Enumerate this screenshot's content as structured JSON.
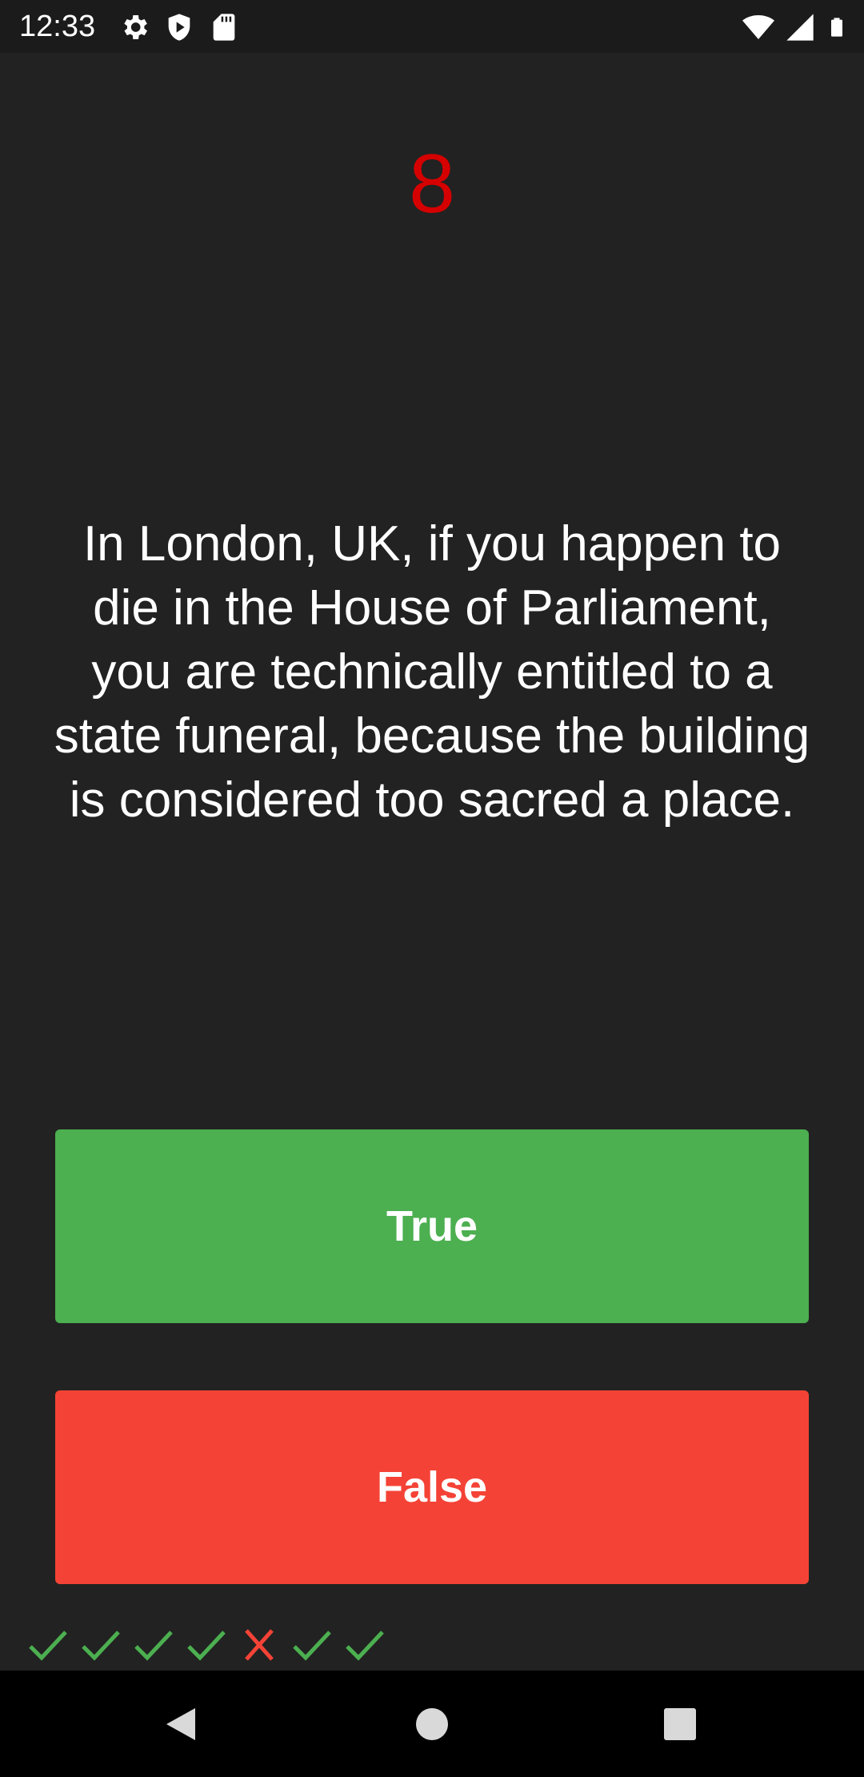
{
  "status_bar": {
    "time": "12:33",
    "left_icons": [
      "settings-icon",
      "shield-icon",
      "sd-card-icon"
    ],
    "right_icons": [
      "wifi-icon",
      "cellular-signal-icon",
      "battery-icon"
    ]
  },
  "quiz": {
    "question_number": "8",
    "question_text": "In London, UK, if you happen to die in the House of Parliament, you are technically entitled to a state funeral, because the building is considered too sacred a place.",
    "true_label": "True",
    "false_label": "False"
  },
  "answer_history": [
    "correct",
    "correct",
    "correct",
    "correct",
    "wrong",
    "correct",
    "correct"
  ],
  "colors": {
    "background": "#222222",
    "question_number": "#d50000",
    "true_button": "#4caf50",
    "false_button": "#f44336",
    "correct_mark": "#4caf50",
    "wrong_mark": "#f44336"
  },
  "nav_bar": {
    "buttons": [
      "back-icon",
      "home-icon",
      "recents-icon"
    ]
  }
}
